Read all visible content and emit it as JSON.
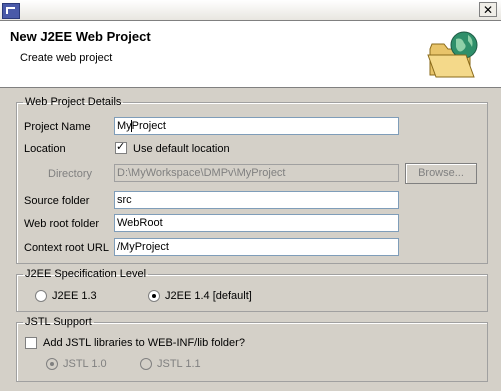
{
  "window": {
    "close_glyph": "✕"
  },
  "header": {
    "title": "New J2EE Web Project",
    "description": "Create web project",
    "icon": "folder-globe-icon"
  },
  "details": {
    "legend": "Web Project Details",
    "project_name": {
      "label": "Project Name",
      "value": "MyProject"
    },
    "location": {
      "label": "Location",
      "checkbox_label": "Use default location",
      "checked": true,
      "check_glyph": "✓"
    },
    "directory": {
      "label": "Directory",
      "value": "D:\\MyWorkspace\\DMPv\\MyProject",
      "browse_label": "Browse..."
    },
    "source_folder": {
      "label": "Source folder",
      "value": "src"
    },
    "web_root": {
      "label": "Web root folder",
      "value": "WebRoot"
    },
    "context_root": {
      "label": "Context root URL",
      "value": "/MyProject"
    }
  },
  "spec": {
    "legend": "J2EE Specification Level",
    "options": [
      {
        "label": "J2EE 1.3",
        "selected": false
      },
      {
        "label": "J2EE 1.4 [default]",
        "selected": true
      }
    ]
  },
  "jstl": {
    "legend": "JSTL Support",
    "checkbox_label": "Add JSTL libraries to WEB-INF/lib folder?",
    "checked": false,
    "options": [
      {
        "label": "JSTL 1.0",
        "selected": true,
        "enabled": false
      },
      {
        "label": "JSTL 1.1",
        "selected": false,
        "enabled": false
      }
    ]
  }
}
